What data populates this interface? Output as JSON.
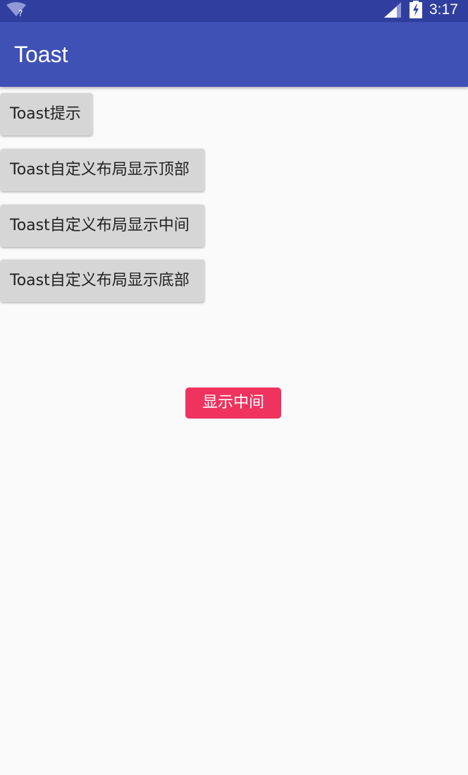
{
  "status_bar": {
    "time": "3:17",
    "wifi_icon": "wifi-unknown-icon",
    "signal_icon": "cell-signal-icon",
    "battery_icon": "battery-charging-icon"
  },
  "app_bar": {
    "title": "Toast",
    "color": "#3f51b5"
  },
  "buttons": [
    {
      "label": "Toast提示"
    },
    {
      "label": "Toast自定义布局显示顶部"
    },
    {
      "label": "Toast自定义布局显示中间"
    },
    {
      "label": "Toast自定义布局显示底部"
    }
  ],
  "toast": {
    "text": "显示中间",
    "color": "#f0325f"
  }
}
